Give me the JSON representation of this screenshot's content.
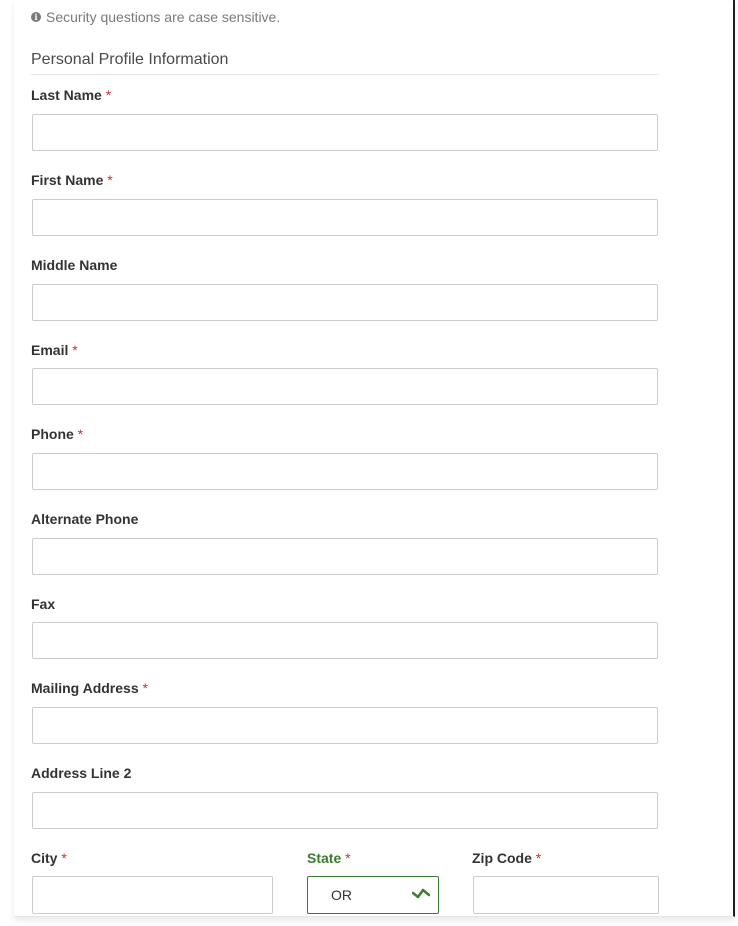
{
  "notice": {
    "icon": "info-icon",
    "text": "Security questions are case sensitive."
  },
  "section_title": "Personal Profile Information",
  "required_marker": "*",
  "fields": {
    "last_name": {
      "label": "Last Name",
      "value": ""
    },
    "first_name": {
      "label": "First Name",
      "value": ""
    },
    "middle_name": {
      "label": "Middle Name",
      "value": ""
    },
    "email": {
      "label": "Email",
      "value": ""
    },
    "phone": {
      "label": "Phone",
      "value": ""
    },
    "alternate_phone": {
      "label": "Alternate Phone",
      "value": ""
    },
    "fax": {
      "label": "Fax",
      "value": ""
    },
    "mailing_address": {
      "label": "Mailing Address",
      "value": ""
    },
    "address_line_2": {
      "label": "Address Line 2",
      "value": ""
    },
    "city": {
      "label": "City",
      "value": ""
    },
    "state": {
      "label": "State",
      "value": "OR",
      "valid_icon": "check-icon"
    },
    "zip": {
      "label": "Zip Code",
      "value": ""
    }
  },
  "colors": {
    "required": "#c9302c",
    "valid": "#3a7d32"
  }
}
